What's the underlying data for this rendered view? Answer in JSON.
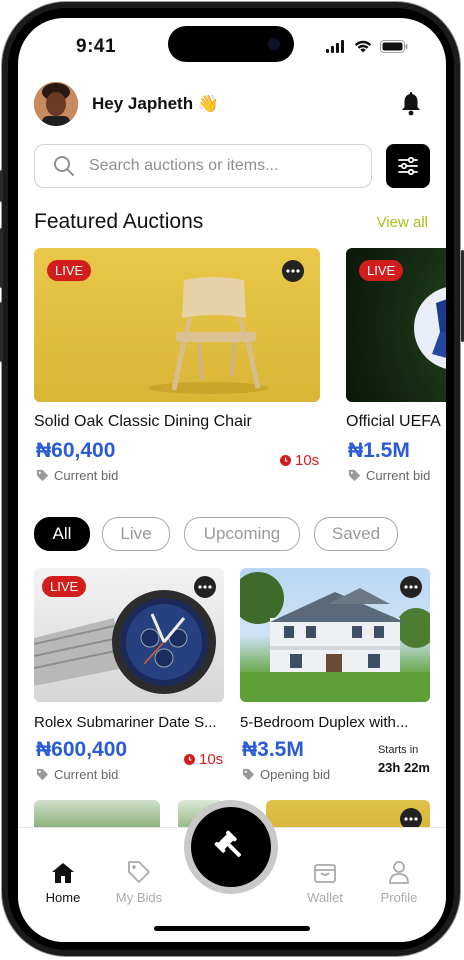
{
  "status_bar": {
    "time": "9:41"
  },
  "header": {
    "greeting": "Hey Japheth 👋"
  },
  "search": {
    "placeholder": "Search auctions or items..."
  },
  "featured": {
    "title": "Featured Auctions",
    "view_all": "View all",
    "items": [
      {
        "badge": "LIVE",
        "title": "Solid Oak Classic Dining Chair",
        "price": "₦60,400",
        "price_label": "Current bid",
        "timer": "10s"
      },
      {
        "badge": "LIVE",
        "title": "Official UEFA",
        "price": "₦1.5M",
        "price_label": "Current bid"
      }
    ]
  },
  "filters": [
    "All",
    "Live",
    "Upcoming",
    "Saved"
  ],
  "grid": [
    {
      "badge": "LIVE",
      "title": "Rolex Submariner Date S...",
      "price": "₦600,400",
      "price_label": "Current bid",
      "timer": "10s"
    },
    {
      "title": "5-Bedroom Duplex with...",
      "price": "₦3.5M",
      "price_label": "Opening bid",
      "starts_label": "Starts in",
      "starts_value": "23h 22m"
    }
  ],
  "tabs": [
    {
      "label": "Home",
      "icon": "home-icon",
      "active": true
    },
    {
      "label": "My Bids",
      "icon": "tag-icon"
    },
    {
      "label": "Wallet",
      "icon": "wallet-icon"
    },
    {
      "label": "Profile",
      "icon": "profile-icon"
    }
  ],
  "colors": {
    "accent": "#a6c21a",
    "price": "#2a5bd7",
    "live": "#d21d1d"
  }
}
